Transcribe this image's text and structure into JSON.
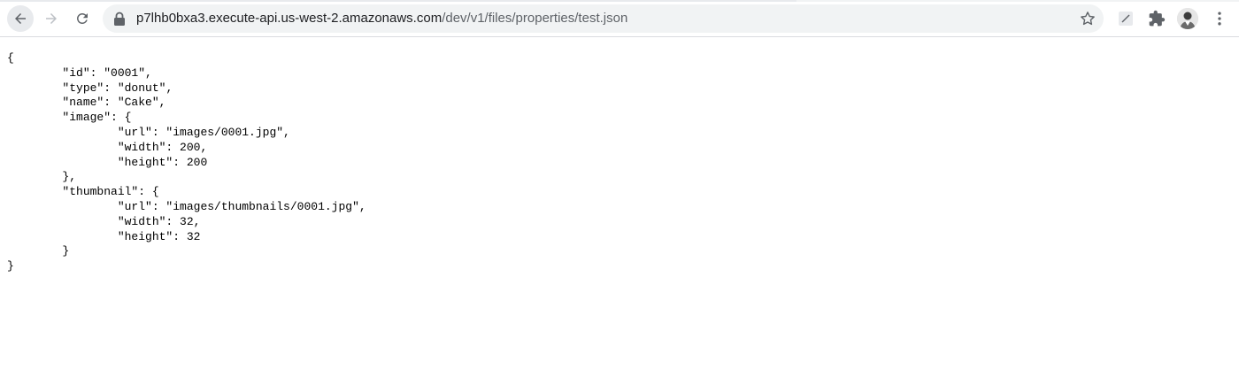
{
  "browser": {
    "url_host": "p7lhb0bxa3.execute-api.us-west-2.amazonaws.com",
    "url_path": "/dev/v1/files/properties/test.json",
    "icons": {
      "back": "arrow-left-icon",
      "forward": "arrow-right-icon",
      "reload": "reload-icon",
      "lock": "lock-icon",
      "bookmark": "star-icon",
      "extension_1": "slash-extension-icon",
      "extensions": "puzzle-icon",
      "profile": "avatar-icon",
      "menu": "kebab-menu-icon"
    },
    "colors": {
      "toolbar_bg": "#ffffff",
      "omnibox_bg": "#f1f3f4",
      "url_host": "#202124",
      "url_path": "#5f6368",
      "icon": "#5f6368"
    }
  },
  "document": {
    "lines": [
      "{",
      "\t\"id\": \"0001\",",
      "\t\"type\": \"donut\",",
      "\t\"name\": \"Cake\",",
      "\t\"image\": {",
      "\t\t\"url\": \"images/0001.jpg\",",
      "\t\t\"width\": 200,",
      "\t\t\"height\": 200",
      "\t},",
      "\t\"thumbnail\": {",
      "\t\t\"url\": \"images/thumbnails/0001.jpg\",",
      "\t\t\"width\": 32,",
      "\t\t\"height\": 32",
      "\t}",
      "}"
    ]
  }
}
